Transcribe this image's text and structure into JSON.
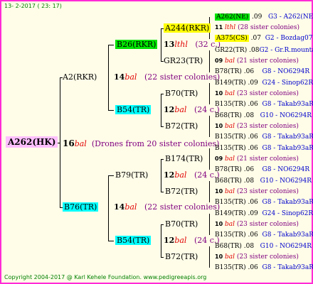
{
  "header": {
    "date": "13-  2-2017  ( 23: 17)"
  },
  "footer": {
    "copyright": "Copyright 2004-2017 @ Karl Kehele Foundation.   www.pedigreeapis.org"
  },
  "colors": {
    "border": "#ff2bd6",
    "background": "#fffde8",
    "root_highlight": "#ffc0ff",
    "green_highlight": "#00e600",
    "yellow_highlight": "#ffff00",
    "cyan_highlight": "#00ffff"
  },
  "root": {
    "id": "A262(HK)",
    "gen": "16",
    "mark": "bal",
    "note": "(Drones from 20 sister colonies)"
  },
  "gen2": [
    {
      "id": "A2(RKR)",
      "gen": "14",
      "mark": "bal",
      "note": "(22 sister colonies)"
    },
    {
      "id": "B76(TR)",
      "gen": "14",
      "mark": "bal",
      "note": "(22 sister colonies)"
    }
  ],
  "gen3": [
    {
      "id": "B26(RKR)",
      "gen": "13",
      "mark": "lthl",
      "note": "(32 c.)"
    },
    {
      "id": "B54(TR)",
      "gen": "12",
      "mark": "bal",
      "note": "(24 c.)"
    },
    {
      "id": "B79(TR)",
      "gen": "12",
      "mark": "bal",
      "note": "(24 c.)"
    },
    {
      "id": "B54(TR)",
      "gen": "12",
      "mark": "bal",
      "note": "(24 c.)"
    }
  ],
  "gen4": [
    {
      "id": "A244(RKR)"
    },
    {
      "id": "GR23(TR)"
    },
    {
      "id": "B70(TR)"
    },
    {
      "id": "B72(TR)"
    },
    {
      "id": "B174(TR)"
    },
    {
      "id": "B72(TR)"
    },
    {
      "id": "B70(TR)"
    },
    {
      "id": "B72(TR)"
    }
  ],
  "gen5": [
    {
      "id": "A262(NE)",
      "year": ".09",
      "origin": "G3 - A262(NE)"
    },
    {
      "gen": "11",
      "mark": "lthl",
      "note": "(28 sister colonies)"
    },
    {
      "id": "A375(CS)",
      "year": ".07",
      "origin": "G2 - Bozdag07R"
    },
    {
      "id": "GR22(TR)",
      "year": ".08",
      "origin": "G2 - Gr.R.mounta"
    },
    {
      "gen": "09",
      "mark": "bal",
      "note": "(21 sister colonies)"
    },
    {
      "id": "B78(TR)",
      "year": ".06",
      "origin": "G8 - NO6294R"
    },
    {
      "id": "B149(TR)",
      "year": ".09",
      "origin": "G24 - Sinop62R"
    },
    {
      "gen": "10",
      "mark": "bal",
      "note": "(23 sister colonies)"
    },
    {
      "id": "B135(TR)",
      "year": ".06",
      "origin": "G8 - Takab93aR"
    },
    {
      "id": "B68(TR)",
      "year": ".08",
      "origin": "G10 - NO6294R"
    },
    {
      "gen": "10",
      "mark": "bal",
      "note": "(23 sister colonies)"
    },
    {
      "id": "B135(TR)",
      "year": ".06",
      "origin": "G8 - Takab93aR"
    },
    {
      "id": "B135(TR)",
      "year": ".06",
      "origin": "G8 - Takab93aR"
    },
    {
      "gen": "09",
      "mark": "bal",
      "note": "(21 sister colonies)"
    },
    {
      "id": "B78(TR)",
      "year": ".06",
      "origin": "G8 - NO6294R"
    },
    {
      "id": "B68(TR)",
      "year": ".08",
      "origin": "G10 - NO6294R"
    },
    {
      "gen": "10",
      "mark": "bal",
      "note": "(23 sister colonies)"
    },
    {
      "id": "B135(TR)",
      "year": ".06",
      "origin": "G8 - Takab93aR"
    },
    {
      "id": "B149(TR)",
      "year": ".09",
      "origin": "G24 - Sinop62R"
    },
    {
      "gen": "10",
      "mark": "bal",
      "note": "(23 sister colonies)"
    },
    {
      "id": "B135(TR)",
      "year": ".06",
      "origin": "G8 - Takab93aR"
    },
    {
      "id": "B68(TR)",
      "year": ".08",
      "origin": "G10 - NO6294R"
    },
    {
      "gen": "10",
      "mark": "bal",
      "note": "(23 sister colonies)"
    },
    {
      "id": "B135(TR)",
      "year": ".06",
      "origin": "G8 - Takab93aR"
    }
  ]
}
